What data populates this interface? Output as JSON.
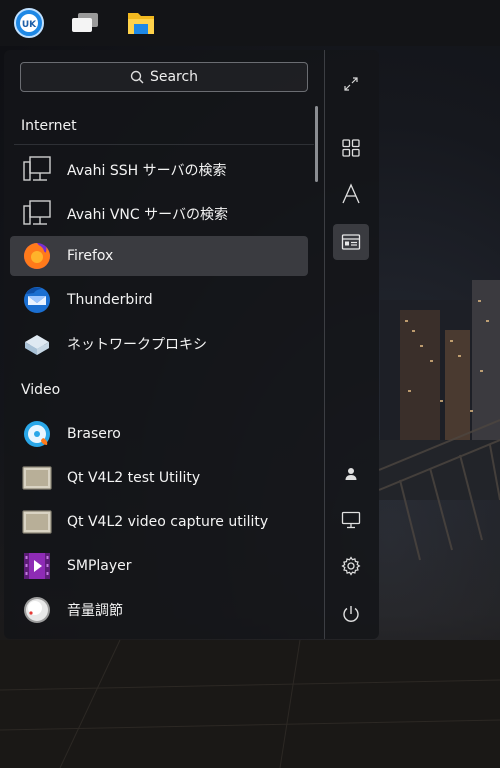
{
  "taskbar": {
    "items": [
      {
        "name": "start-menu-button",
        "icon": "uk-logo-icon"
      },
      {
        "name": "window-switcher-button",
        "icon": "windows-icon"
      },
      {
        "name": "file-manager-button",
        "icon": "folder-icon"
      }
    ]
  },
  "menu": {
    "search": {
      "label": "Search",
      "icon": "search-icon"
    },
    "categories": [
      {
        "label": "Internet"
      },
      {
        "label": "Video"
      }
    ],
    "items": [
      {
        "label": "Avahi SSH サーバの検索",
        "icon": "network-computer-icon"
      },
      {
        "label": "Avahi VNC サーバの検索",
        "icon": "network-computer-icon"
      },
      {
        "label": "Firefox",
        "icon": "firefox-icon",
        "selected": true
      },
      {
        "label": "Thunderbird",
        "icon": "thunderbird-icon"
      },
      {
        "label": "ネットワークプロキシ",
        "icon": "network-proxy-icon"
      },
      {
        "label": "Brasero",
        "icon": "brasero-icon"
      },
      {
        "label": "Qt V4L2 test Utility",
        "icon": "qt-v4l2-icon"
      },
      {
        "label": "Qt V4L2 video capture utility",
        "icon": "qt-v4l2-icon"
      },
      {
        "label": "SMPlayer",
        "icon": "smplayer-icon"
      },
      {
        "label": "音量調節",
        "icon": "volume-knob-icon"
      }
    ]
  },
  "sidebar": {
    "buttons": [
      {
        "name": "fullscreen-button",
        "icon": "expand-icon"
      },
      {
        "name": "all-apps-view-button",
        "icon": "grid-icon"
      },
      {
        "name": "letter-sort-button",
        "icon": "letter-a-icon"
      },
      {
        "name": "category-view-button",
        "icon": "category-icon",
        "active": true
      },
      {
        "name": "user-button",
        "icon": "user-icon"
      },
      {
        "name": "computer-button",
        "icon": "monitor-icon"
      },
      {
        "name": "settings-button",
        "icon": "gear-icon"
      },
      {
        "name": "power-button",
        "icon": "power-icon"
      }
    ]
  },
  "colors": {
    "panel": "#141519",
    "selected": "#3a3b40",
    "accent": "#1e88e5"
  }
}
